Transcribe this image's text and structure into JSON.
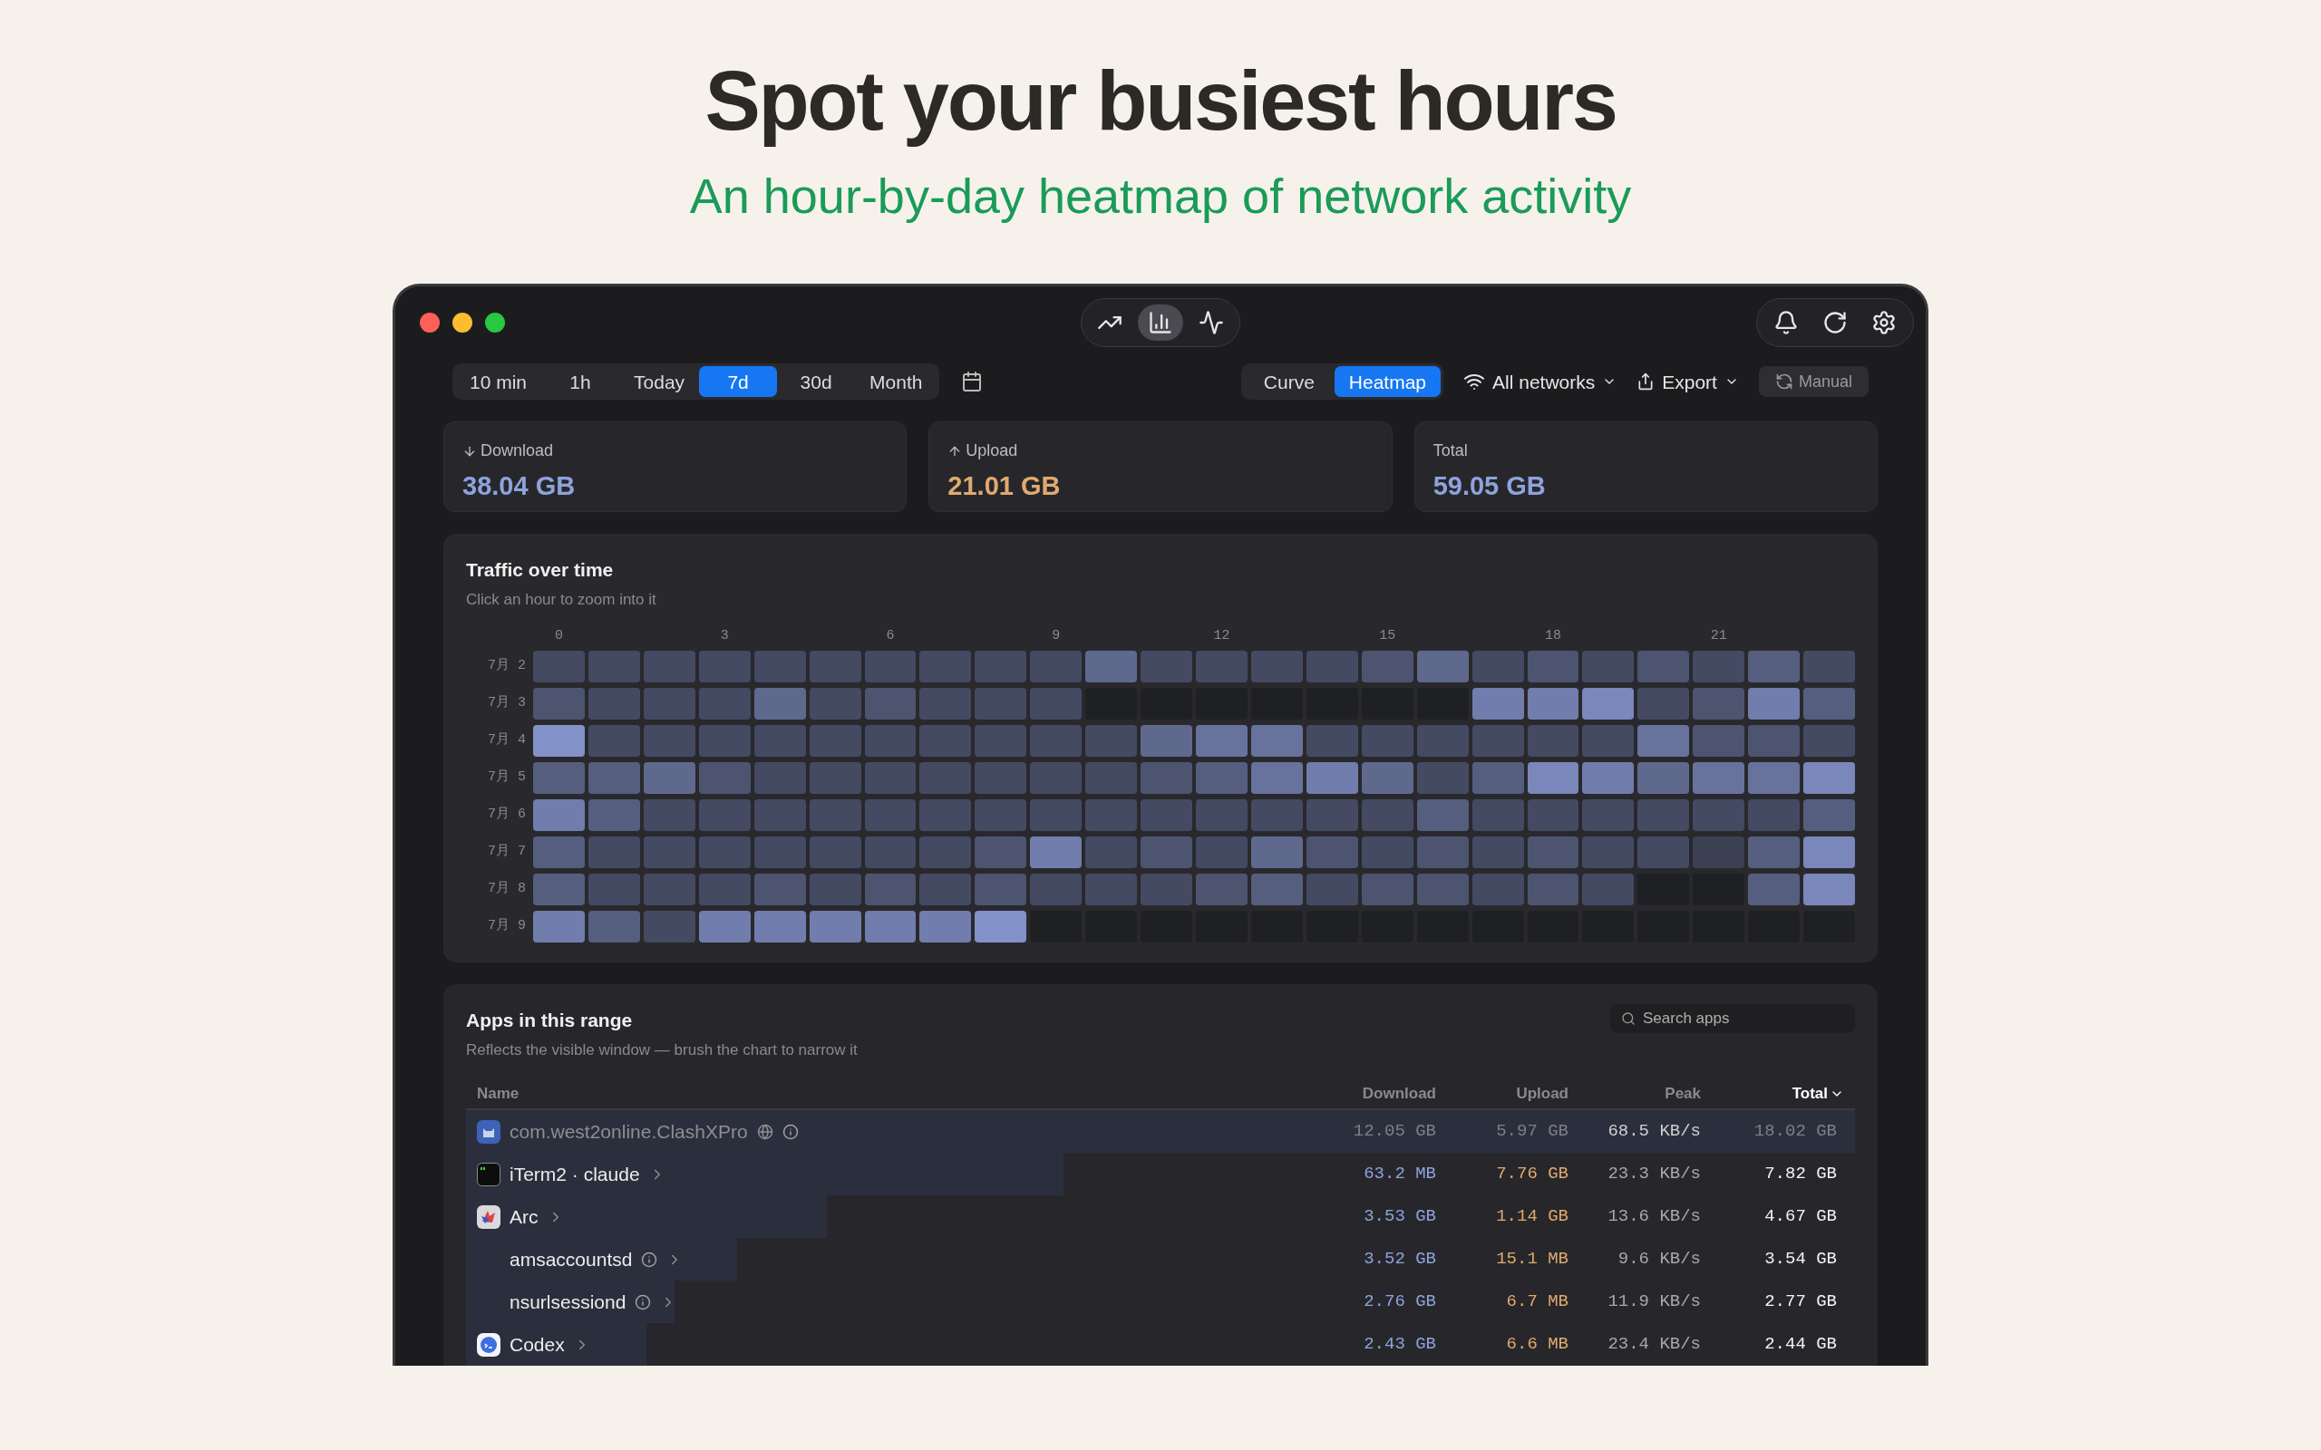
{
  "headline": "Spot your busiest hours",
  "subheadline": "An hour-by-day heatmap of network activity",
  "toolbar": {
    "views": [
      {
        "kind": "line",
        "selected": false
      },
      {
        "kind": "bars",
        "selected": true
      },
      {
        "kind": "pulse",
        "selected": false
      }
    ]
  },
  "ranges": [
    {
      "label": "10 min",
      "selected": false
    },
    {
      "label": "1h",
      "selected": false
    },
    {
      "label": "Today",
      "selected": false
    },
    {
      "label": "7d",
      "selected": true
    },
    {
      "label": "30d",
      "selected": false
    },
    {
      "label": "Month",
      "selected": false
    }
  ],
  "modes": [
    {
      "label": "Curve",
      "selected": false
    },
    {
      "label": "Heatmap",
      "selected": true
    }
  ],
  "network_menu": "All networks",
  "export_menu": "Export",
  "manual_button": "Manual",
  "stats": [
    {
      "kind": "download",
      "label": "Download",
      "value": "38.04 GB"
    },
    {
      "kind": "upload",
      "label": "Upload",
      "value": "21.01 GB"
    },
    {
      "kind": "total",
      "label": "Total",
      "value": "59.05 GB"
    }
  ],
  "heatmap": {
    "title": "Traffic over time",
    "subtitle": "Click an hour to zoom into it",
    "hours": [
      "0",
      "3",
      "6",
      "9",
      "12",
      "15",
      "18",
      "21"
    ],
    "rows": [
      "7月 2",
      "7月 3",
      "7月 4",
      "7月 5",
      "7月 6",
      "7月 7",
      "7月 8",
      "7月 9"
    ]
  },
  "apps": {
    "title": "Apps in this range",
    "subtitle": "Reflects the visible window — brush the chart to narrow it",
    "search": {
      "placeholder": "Search apps"
    },
    "columns": [
      {
        "label": "Name",
        "sorted": false
      },
      {
        "label": "Download",
        "sorted": false
      },
      {
        "label": "Upload",
        "sorted": false
      },
      {
        "label": "Peak",
        "sorted": false
      },
      {
        "label": "Total",
        "sorted": true
      }
    ],
    "rows": [
      {
        "kind": "cat",
        "name": "com.west2online.ClashXPro",
        "muted": true,
        "globe": true,
        "info": true,
        "chevron": false,
        "level": 1,
        "download": "12.05 GB",
        "upload": "5.97 GB",
        "peak": "68.5 KB/s",
        "total": "18.02 GB"
      },
      {
        "kind": "terminal",
        "name": "iTerm2 · claude",
        "muted": false,
        "globe": false,
        "info": false,
        "chevron": true,
        "level": 0.43,
        "download": "63.2 MB",
        "upload": "7.76 GB",
        "peak": "23.3 KB/s",
        "total": "7.82 GB"
      },
      {
        "kind": "arc",
        "name": "Arc",
        "muted": false,
        "globe": false,
        "info": false,
        "chevron": true,
        "level": 0.26,
        "download": "3.53 GB",
        "upload": "1.14 GB",
        "peak": "13.6 KB/s",
        "total": "4.67 GB"
      },
      {
        "kind": "none",
        "name": "amsaccountsd",
        "muted": false,
        "globe": false,
        "info": true,
        "chevron": true,
        "level": 0.195,
        "download": "3.52 GB",
        "upload": "15.1 MB",
        "peak": "9.6 KB/s",
        "total": "3.54 GB"
      },
      {
        "kind": "none",
        "name": "nsurlsessiond",
        "muted": false,
        "globe": false,
        "info": true,
        "chevron": true,
        "level": 0.15,
        "download": "2.76 GB",
        "upload": "6.7 MB",
        "peak": "11.9 KB/s",
        "total": "2.77 GB"
      },
      {
        "kind": "cloud",
        "name": "Codex",
        "muted": false,
        "globe": false,
        "info": false,
        "chevron": true,
        "level": 0.13,
        "download": "2.43 GB",
        "upload": "6.6 MB",
        "peak": "23.4 KB/s",
        "total": "2.44 GB"
      }
    ]
  }
}
